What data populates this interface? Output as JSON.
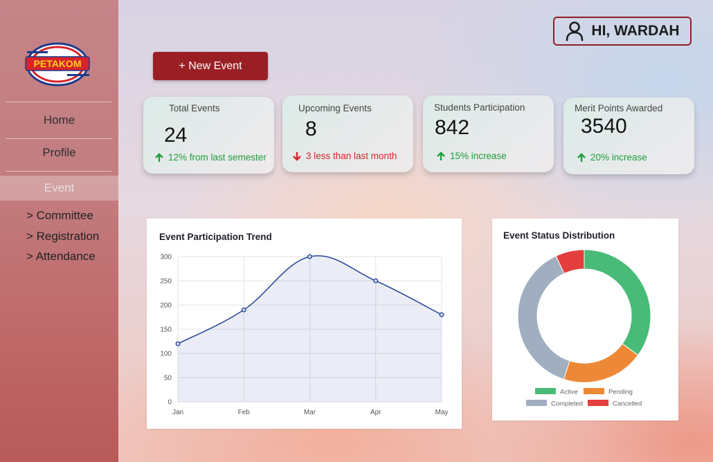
{
  "brand": {
    "logo_text": "PETAKOM"
  },
  "sidebar": {
    "items": [
      {
        "label": "Home"
      },
      {
        "label": "Profile"
      },
      {
        "label": "Event"
      }
    ],
    "sub_items": [
      {
        "label": "> Committee"
      },
      {
        "label": "> Registration"
      },
      {
        "label": "> Attendance"
      }
    ]
  },
  "header": {
    "greeting": "HI, WARDAH",
    "user_icon": "user-icon"
  },
  "actions": {
    "new_event_label": "+ New Event"
  },
  "stats": [
    {
      "label": "Total Events",
      "value": "24",
      "change": "12% from last semester",
      "direction": "up"
    },
    {
      "label": "Upcoming Events",
      "value": "8",
      "change": "3 less than last month",
      "direction": "down"
    },
    {
      "label": "Students Participation",
      "value": "842",
      "change": "15% increase",
      "direction": "up"
    },
    {
      "label": "Merit Points Awarded",
      "value": "3540",
      "change": "20% increase",
      "direction": "up"
    }
  ],
  "colors": {
    "brand_red": "#9a1f24",
    "up": "#1e9e3a",
    "down": "#d8232a",
    "line": "#2e4a9a",
    "active": "#48bb78",
    "pending": "#ed8936",
    "completed": "#a0aec0",
    "cancelled": "#e53e3e"
  },
  "chart_data": [
    {
      "type": "line",
      "title": "Event Participation Trend",
      "x": [
        "Jan",
        "Feb",
        "Mar",
        "Apr",
        "May"
      ],
      "series": [
        {
          "values": [
            120,
            190,
            300,
            250,
            180
          ]
        }
      ],
      "ylim": [
        0,
        300
      ],
      "yticks": [
        0,
        50,
        100,
        150,
        200,
        250,
        300
      ],
      "grid": true,
      "fill": true
    },
    {
      "type": "pie",
      "title": "Event Status Distribution",
      "categories": [
        "Active",
        "Pending",
        "Completed",
        "Cancelled"
      ],
      "values": [
        35,
        20,
        38,
        7
      ],
      "legend": "bottom"
    }
  ]
}
